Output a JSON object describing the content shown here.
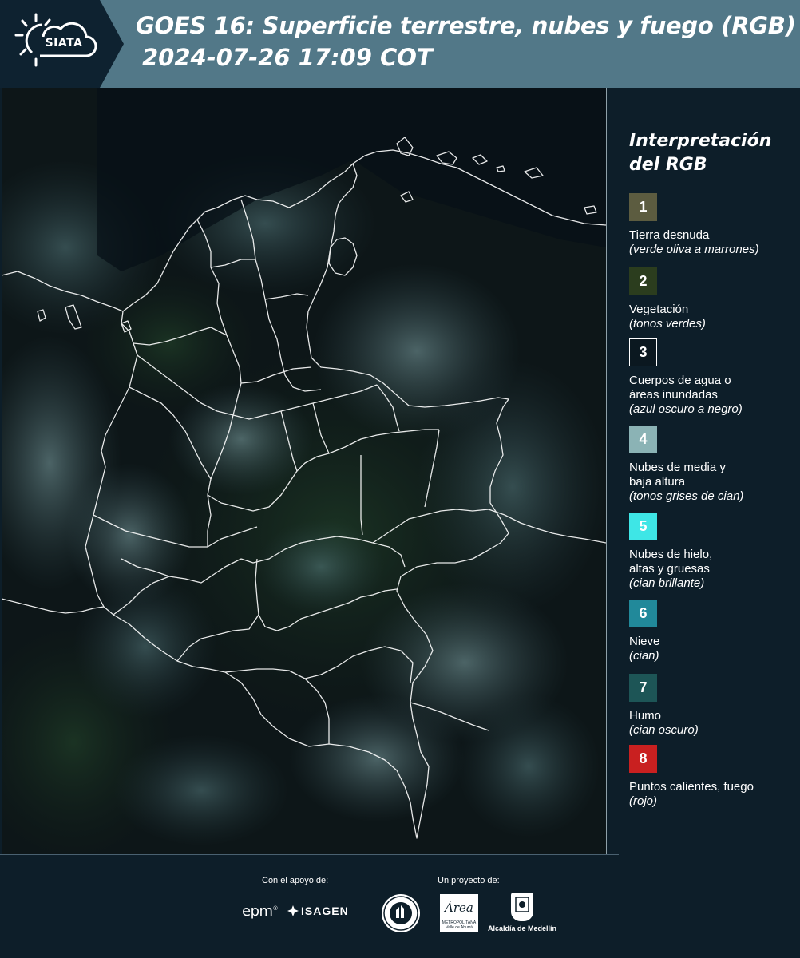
{
  "header": {
    "logo_text": "SIATA",
    "title": "GOES 16: Superficie terrestre, nubes y fuego (RGB)",
    "subtitle": "2024-07-26 17:09 COT"
  },
  "map": {
    "background_color": "#0b1215",
    "border_color": "#ffffff"
  },
  "legend": {
    "title_line1": "Interpretación",
    "title_line2": "del RGB",
    "items": [
      {
        "number": "1",
        "color": "#5c5c40",
        "label": "Tierra desnuda",
        "hint": "(verde oliva a marrones)"
      },
      {
        "number": "2",
        "color": "#2b3d1e",
        "label": "Vegetación",
        "hint": "(tonos verdes)"
      },
      {
        "number": "3",
        "color": "#0b1820",
        "label": "Cuerpos de agua o áreas inundadas",
        "hint": "(azul oscuro a negro)"
      },
      {
        "number": "4",
        "color": "#8bb3b5",
        "label": "Nubes de media y baja altura",
        "hint": "(tonos grises de cian)"
      },
      {
        "number": "5",
        "color": "#3ee6e6",
        "label": "Nubes de hielo, altas y gruesas",
        "hint": "(cian brillante)"
      },
      {
        "number": "6",
        "color": "#21899a",
        "label": "Nieve",
        "hint": "(cian)"
      },
      {
        "number": "7",
        "color": "#1d5556",
        "label": "Humo",
        "hint": "(cian oscuro)"
      },
      {
        "number": "8",
        "color": "#c92020",
        "label": "Puntos calientes, fuego",
        "hint": "(rojo)"
      }
    ]
  },
  "footer": {
    "support_label": "Con el apoyo de:",
    "project_label": "Un proyecto de:",
    "epm_logo": "epm",
    "epm_mark": "®",
    "isagen_logo": "ISAGEN",
    "area_logo": "Área",
    "area_logo_sub": "METROPOLITANA Valle de Aburrá",
    "alcaldia_logo": "Alcaldía de Medellín"
  }
}
